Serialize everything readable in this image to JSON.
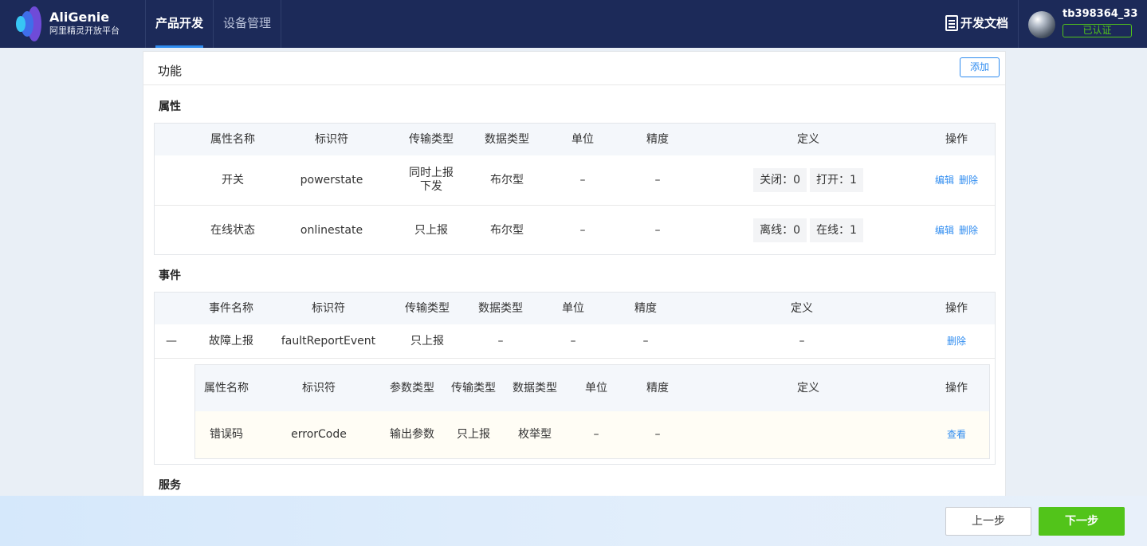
{
  "header": {
    "brand": "AliGenie",
    "brand_sub": "阿里精灵开放平台",
    "nav": [
      {
        "label": "产品开发",
        "active": true
      },
      {
        "label": "设备管理",
        "active": false
      }
    ],
    "docs_label": "开发文档",
    "username": "tb398364_33",
    "verified_label": "已认证"
  },
  "card": {
    "title": "功能",
    "add_label": "添加"
  },
  "properties": {
    "title": "属性",
    "columns": [
      "属性名称",
      "标识符",
      "传输类型",
      "数据类型",
      "单位",
      "精度",
      "定义",
      "操作"
    ],
    "rows": [
      {
        "name": "开关",
        "id": "powerstate",
        "transfer": "同时上报下发",
        "dtype": "布尔型",
        "unit": "–",
        "precision": "–",
        "def": [
          "关闭：0",
          "打开：1"
        ],
        "edit": "编辑",
        "delete": "删除"
      },
      {
        "name": "在线状态",
        "id": "onlinestate",
        "transfer": "只上报",
        "dtype": "布尔型",
        "unit": "–",
        "precision": "–",
        "def": [
          "离线：0",
          "在线：1"
        ],
        "edit": "编辑",
        "delete": "删除"
      }
    ]
  },
  "events": {
    "title": "事件",
    "columns": [
      "事件名称",
      "标识符",
      "传输类型",
      "数据类型",
      "单位",
      "精度",
      "定义",
      "操作"
    ],
    "row": {
      "collapse": "—",
      "name": "故障上报",
      "id": "faultReportEvent",
      "transfer": "只上报",
      "dtype": "–",
      "unit": "–",
      "precision": "–",
      "def": "–",
      "delete": "删除"
    },
    "sub_columns": [
      "属性名称",
      "标识符",
      "参数类型",
      "传输类型",
      "数据类型",
      "单位",
      "精度",
      "定义",
      "操作"
    ],
    "sub_row": {
      "name": "错误码",
      "id": "errorCode",
      "param_type": "输出参数",
      "transfer": "只上报",
      "dtype": "枚举型",
      "unit": "–",
      "precision": "–",
      "def": "",
      "view": "查看"
    }
  },
  "services": {
    "title": "服务"
  },
  "footer": {
    "prev_label": "上一步",
    "next_label": "下一步"
  }
}
